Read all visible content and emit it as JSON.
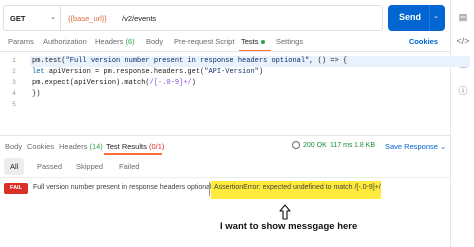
{
  "request": {
    "method": "GET",
    "url_variable": "{{base_url}}",
    "url_path": "/v2/events",
    "send_label": "Send"
  },
  "request_tabs": [
    {
      "label": "Params"
    },
    {
      "label": "Authorization"
    },
    {
      "label": "Headers",
      "count": "(6)"
    },
    {
      "label": "Body"
    },
    {
      "label": "Pre-request Script"
    },
    {
      "label": "Tests",
      "active": true
    },
    {
      "label": "Settings"
    }
  ],
  "cookies_label": "Cookies",
  "code_lines": [
    "1",
    "2",
    "3",
    "4",
    "5"
  ],
  "code": {
    "l1a": "pm.test(",
    "l1b": "\"Full version number present in response headers optional\"",
    "l1c": ", () => {",
    "l2a": "let ",
    "l2b": "apiVersion = pm.response.headers.get(",
    "l2c": "\"API-Version\"",
    "l2d": ")",
    "l3a": "pm.expect(apiVersion).match(",
    "l3b": "/[-.0-9]+/",
    "l3c": ")",
    "l4": "})"
  },
  "response_tabs": [
    {
      "label": "Body"
    },
    {
      "label": "Cookies"
    },
    {
      "label": "Headers",
      "count": "(14)"
    },
    {
      "label": "Test Results",
      "count": "(0/1)",
      "active": true
    }
  ],
  "response_meta": {
    "status": "200 OK",
    "time": "117 ms",
    "size": "1.8 KB",
    "save_label": "Save Response"
  },
  "filters": [
    "All",
    "Passed",
    "Skipped",
    "Failed"
  ],
  "result": {
    "badge": "FAIL",
    "name": "Full version number present in response headers optional",
    "error": "AssertionError: expected undefined to match /[-.0-9]+/"
  },
  "annotation": "I want to show messgage here",
  "colors": {
    "accent": "#ff6c37",
    "send": "#0265d2",
    "fail": "#d93025",
    "highlight": "#ffeb3b"
  }
}
